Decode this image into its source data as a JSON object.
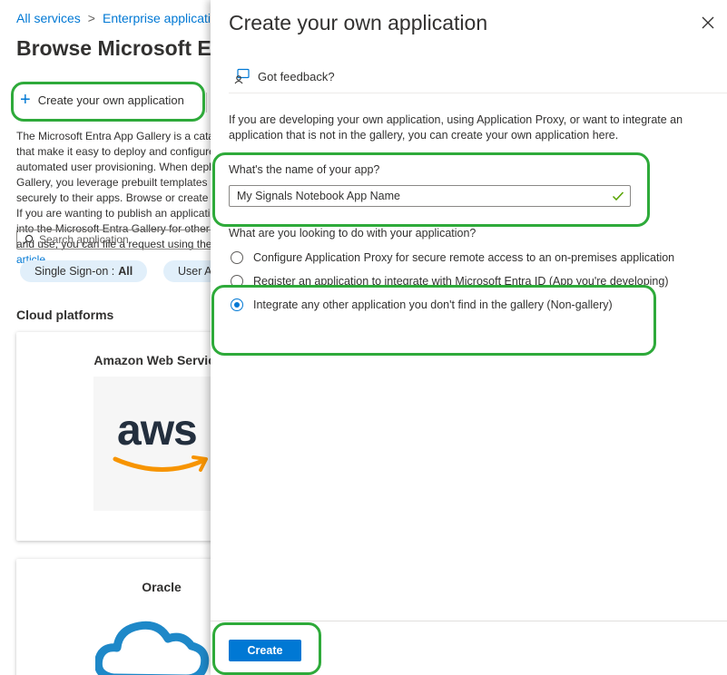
{
  "breadcrumb": {
    "item1": "All services",
    "item2": "Enterprise applications"
  },
  "page": {
    "title": "Browse Microsoft Entra Gallery",
    "create_label": "Create your own application",
    "desc_text": "The Microsoft Entra App Gallery is a catalog of thousands of apps that make it easy to deploy and configure single sign-on (SSO) and automated user provisioning. When deploying an app from the App Gallery, you leverage prebuilt templates to connect your users more securely to their apps. Browse or create your own application here. If you are wanting to publish an application you have developed into the Microsoft Entra Gallery for other organizations to discover and use, you can file a request using the process described in ",
    "desc_link": "this article.",
    "search_placeholder": "Search application",
    "pill1_label": "Single Sign-on :",
    "pill1_value": "All",
    "pill2_label": "User Account Management",
    "section_title": "Cloud platforms",
    "card1_title": "Amazon Web Services",
    "card1_logo": "aws",
    "card2_title": "Oracle"
  },
  "panel": {
    "title": "Create your own application",
    "feedback": "Got feedback?",
    "intro": "If you are developing your own application, using Application Proxy, or want to integrate an application that is not in the gallery, you can create your own application here.",
    "name_label": "What's the name of your app?",
    "name_value": "My Signals Notebook App Name",
    "purpose_label": "What are you looking to do with your application?",
    "options": [
      {
        "label": "Configure Application Proxy for secure remote access to an on-premises application",
        "selected": false
      },
      {
        "label": "Register an application to integrate with Microsoft Entra ID (App you're developing)",
        "selected": false
      },
      {
        "label": "Integrate any other application you don't find in the gallery (Non-gallery)",
        "selected": true
      }
    ],
    "create_button": "Create"
  },
  "colors": {
    "accent": "#0078d4",
    "highlight": "#2eaa3a"
  }
}
